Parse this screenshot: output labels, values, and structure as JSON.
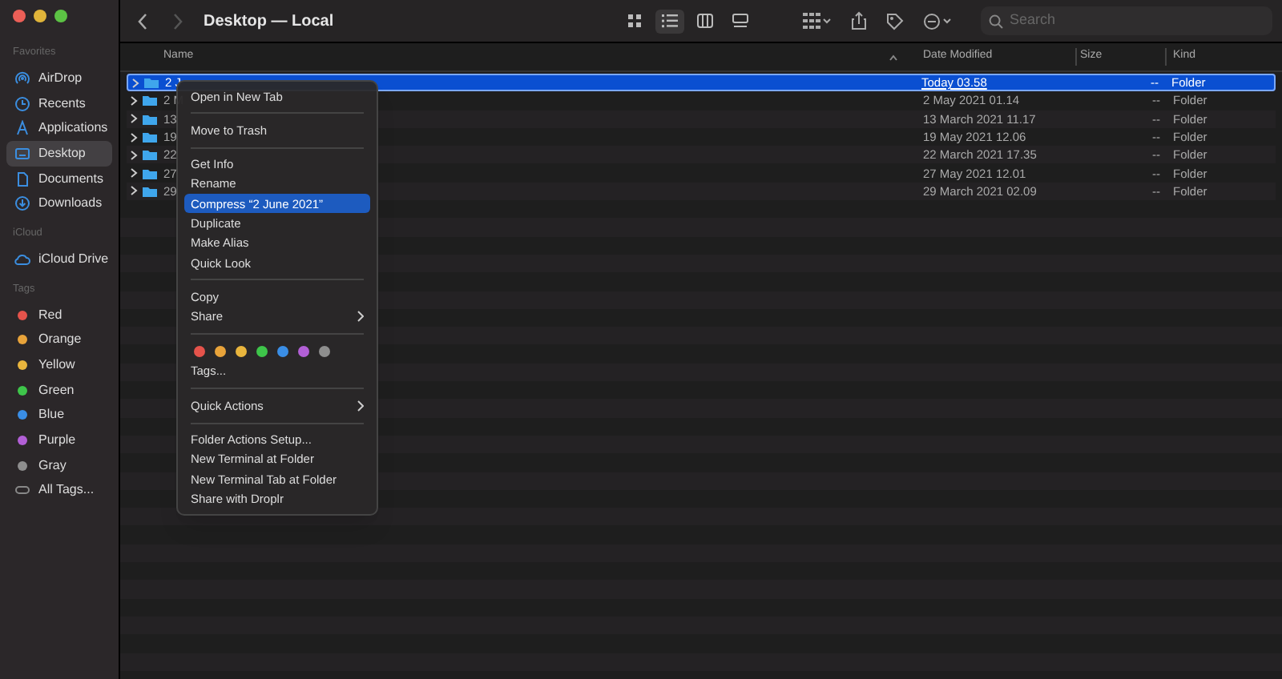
{
  "window": {
    "title": "Desktop — Local"
  },
  "toolbar": {
    "views": [
      {
        "selected": false
      },
      {
        "selected": true
      },
      {
        "selected": false
      },
      {
        "selected": false
      }
    ],
    "search": {
      "placeholder": "Search"
    }
  },
  "sidebar": {
    "sections": [
      {
        "title": "Favorites",
        "items": [
          {
            "label": "AirDrop",
            "selected": false
          },
          {
            "label": "Recents",
            "selected": false
          },
          {
            "label": "Applications",
            "selected": false
          },
          {
            "label": "Desktop",
            "selected": true
          },
          {
            "label": "Documents",
            "selected": false
          },
          {
            "label": "Downloads",
            "selected": false
          }
        ]
      },
      {
        "title": "iCloud",
        "items": [
          {
            "label": "iCloud Drive",
            "selected": false
          }
        ]
      },
      {
        "title": "Tags",
        "items": [
          {
            "label": "Red",
            "color": "#e5534b"
          },
          {
            "label": "Orange",
            "color": "#e8a33a"
          },
          {
            "label": "Yellow",
            "color": "#e9b53d"
          },
          {
            "label": "Green",
            "color": "#3ec54a"
          },
          {
            "label": "Blue",
            "color": "#3a8ee6"
          },
          {
            "label": "Purple",
            "color": "#b25fd6"
          },
          {
            "label": "Gray",
            "color": "#8e8e8e"
          },
          {
            "label": "All Tags..."
          }
        ]
      }
    ]
  },
  "table": {
    "columns": [
      "Name",
      "Date Modified",
      "Size",
      "Kind"
    ],
    "rows": [
      {
        "name": "2 J",
        "date": "Today 03.58",
        "size": "--",
        "kind": "Folder",
        "selected": true
      },
      {
        "name": "2 M",
        "date": "2 May 2021 01.14",
        "size": "--",
        "kind": "Folder",
        "selected": false
      },
      {
        "name": "13",
        "date": "13 March 2021 11.17",
        "size": "--",
        "kind": "Folder",
        "selected": false
      },
      {
        "name": "19",
        "date": "19 May 2021 12.06",
        "size": "--",
        "kind": "Folder",
        "selected": false
      },
      {
        "name": "22",
        "date": "22 March 2021 17.35",
        "size": "--",
        "kind": "Folder",
        "selected": false
      },
      {
        "name": "27",
        "date": "27 May 2021 12.01",
        "size": "--",
        "kind": "Folder",
        "selected": false
      },
      {
        "name": "29",
        "date": "29 March 2021 02.09",
        "size": "--",
        "kind": "Folder",
        "selected": false
      }
    ]
  },
  "context_menu": {
    "items": [
      {
        "kind": "item",
        "label": "Open in New Tab",
        "selected": false
      },
      {
        "kind": "separator"
      },
      {
        "kind": "item",
        "label": "Move to Trash",
        "selected": false
      },
      {
        "kind": "separator"
      },
      {
        "kind": "item",
        "label": "Get Info",
        "selected": false
      },
      {
        "kind": "item",
        "label": "Rename",
        "selected": false
      },
      {
        "kind": "item",
        "label": "Compress “2 June 2021”",
        "selected": true
      },
      {
        "kind": "item",
        "label": "Duplicate",
        "selected": false
      },
      {
        "kind": "item",
        "label": "Make Alias",
        "selected": false
      },
      {
        "kind": "item",
        "label": "Quick Look",
        "selected": false
      },
      {
        "kind": "separator"
      },
      {
        "kind": "item",
        "label": "Copy",
        "selected": false
      },
      {
        "kind": "submenu",
        "label": "Share",
        "selected": false
      },
      {
        "kind": "separator"
      },
      {
        "kind": "tags",
        "colors": [
          {
            "color": "#e5534b"
          },
          {
            "color": "#e8a33a"
          },
          {
            "color": "#e9b53d"
          },
          {
            "color": "#3ec54a"
          },
          {
            "color": "#3a8ee6"
          },
          {
            "color": "#b25fd6"
          },
          {
            "color": "#8e8e8e"
          }
        ]
      },
      {
        "kind": "item",
        "label": "Tags...",
        "selected": false
      },
      {
        "kind": "separator"
      },
      {
        "kind": "submenu",
        "label": "Quick Actions",
        "selected": false
      },
      {
        "kind": "separator"
      },
      {
        "kind": "item",
        "label": "Folder Actions Setup...",
        "selected": false
      },
      {
        "kind": "item",
        "label": "New Terminal at Folder",
        "selected": false
      },
      {
        "kind": "item",
        "label": "New Terminal Tab at Folder",
        "selected": false
      },
      {
        "kind": "item",
        "label": "Share with Droplr",
        "selected": false
      }
    ]
  }
}
